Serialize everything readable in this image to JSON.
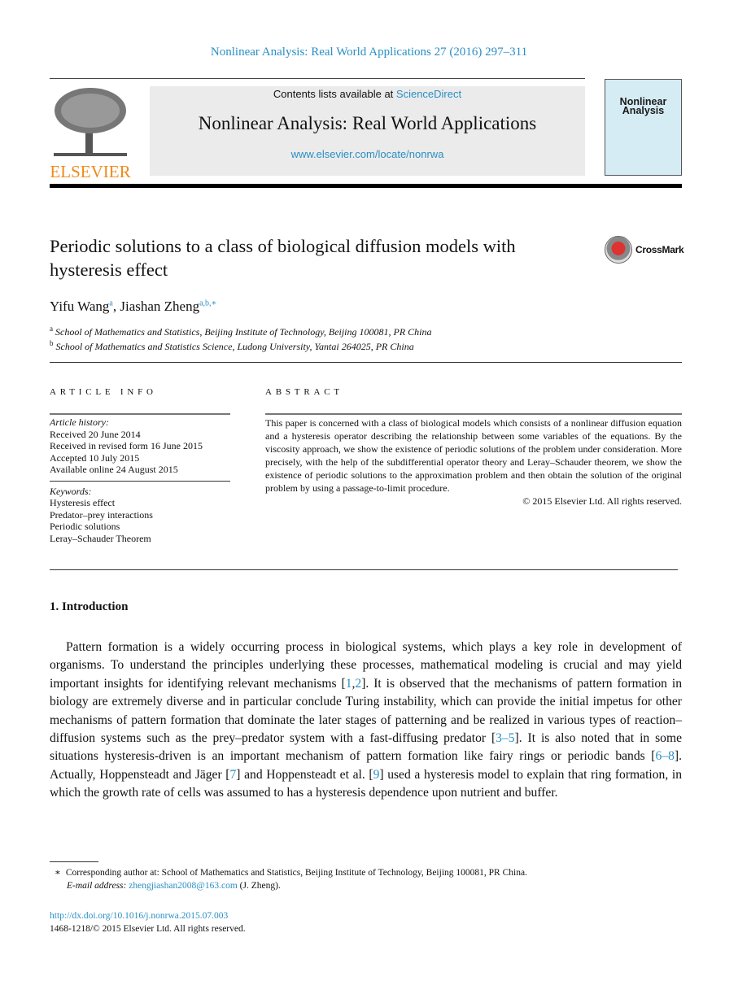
{
  "header": {
    "citation": "Nonlinear Analysis: Real World Applications 27 (2016) 297–311",
    "contents_prefix": "Contents lists available at ",
    "contents_link": "ScienceDirect",
    "journal_title": "Nonlinear Analysis: Real World Applications",
    "journal_url": "www.elsevier.com/locate/nonrwa",
    "publisher_logo": "ELSEVIER",
    "cover_title": "Nonlinear Analysis",
    "accent_color": "#2a8fc4",
    "logo_color": "#f08a1c"
  },
  "article": {
    "title": "Periodic solutions to a class of biological diffusion models with hysteresis effect",
    "crossmark": "CrossMark",
    "authors": [
      {
        "name": "Yifu Wang",
        "sup": "a"
      },
      {
        "name": "Jiashan Zheng",
        "sup": "a,b,∗"
      }
    ],
    "affiliations": [
      {
        "mark": "a",
        "text": "School of Mathematics and Statistics, Beijing Institute of Technology, Beijing 100081, PR China"
      },
      {
        "mark": "b",
        "text": "School of Mathematics and Statistics Science, Ludong University, Yantai 264025, PR China"
      }
    ]
  },
  "info": {
    "heading": "ARTICLE INFO",
    "history_label": "Article history:",
    "history": [
      "Received 20 June 2014",
      "Received in revised form 16 June 2015",
      "Accepted 10 July 2015",
      "Available online 24 August 2015"
    ],
    "keywords_label": "Keywords:",
    "keywords": [
      "Hysteresis effect",
      "Predator–prey interactions",
      "Periodic solutions",
      "Leray–Schauder Theorem"
    ]
  },
  "abstract": {
    "heading": "ABSTRACT",
    "text": "This paper is concerned with a class of biological models which consists of a nonlinear diffusion equation and a hysteresis operator describing the relationship between some variables of the equations. By the viscosity approach, we show the existence of periodic solutions of the problem under consideration. More precisely, with the help of the subdifferential operator theory and Leray–Schauder theorem, we show the existence of periodic solutions to the approximation problem and then obtain the solution of the original problem by using a passage-to-limit procedure.",
    "copyright": "© 2015 Elsevier Ltd. All rights reserved."
  },
  "intro": {
    "heading": "1.  Introduction",
    "segments": [
      "Pattern formation is a widely occurring process in biological systems, which plays a key role in development of organisms. To understand the principles underlying these processes, mathematical modeling is crucial and may yield important insights for identifying relevant mechanisms [",
      "1",
      ",",
      "2",
      "]. It is observed that the mechanisms of pattern formation in biology are extremely diverse and in particular conclude Turing instability, which can provide the initial impetus for other mechanisms of pattern formation that dominate the later stages of patterning and be realized in various types of reaction–diffusion systems such as the prey–predator system with a fast-diffusing predator [",
      "3–5",
      "]. It is also noted that in some situations hysteresis-driven is an important mechanism of pattern formation like fairy rings or periodic bands [",
      "6–8",
      "]. Actually, Hoppensteadt and Jäger [",
      "7",
      "] and Hoppensteadt et al. [",
      "9",
      "] used a hysteresis model to explain that ring formation, in which the growth rate of cells was assumed to has a hysteresis dependence upon nutrient and buffer."
    ]
  },
  "footnote": {
    "mark": "∗",
    "corresponding": "Corresponding author at: School of Mathematics and Statistics, Beijing Institute of Technology, Beijing 100081, PR China.",
    "email_label": "E-mail address:",
    "email": "zhengjiashan2008@163.com",
    "email_suffix": " (J. Zheng).",
    "doi": "http://dx.doi.org/10.1016/j.nonrwa.2015.07.003",
    "issn": "1468-1218/© 2015 Elsevier Ltd. All rights reserved."
  }
}
